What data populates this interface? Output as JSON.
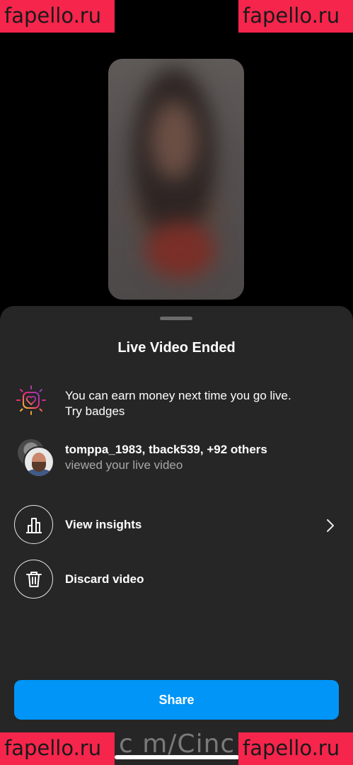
{
  "watermark": {
    "text": "fapello.ru",
    "bottom_overlay": "c m/Cinc"
  },
  "sheet": {
    "title": "Live Video Ended",
    "badges": {
      "line1": "You can earn money next time you go live.",
      "line2": "Try badges"
    },
    "viewers": {
      "names": "tomppa_1983, tback539, +92 others",
      "subtitle": "viewed your live video"
    },
    "actions": [
      {
        "label": "View insights",
        "icon": "bar-chart-icon",
        "has_chevron": true
      },
      {
        "label": "Discard video",
        "icon": "trash-icon",
        "has_chevron": false
      }
    ],
    "share_label": "Share"
  },
  "colors": {
    "sheet_background": "#262626",
    "accent_blue": "#0095f6",
    "secondary_text": "#a8a8a8",
    "watermark": "#f5254c"
  }
}
